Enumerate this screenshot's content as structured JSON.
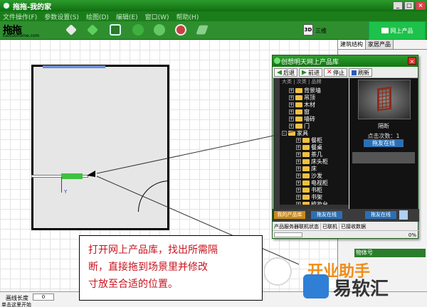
{
  "window": {
    "title": "拖拖-我的家",
    "menu": [
      "文件操作(F)",
      "参数设置(S)",
      "绘图(D)",
      "编辑(E)",
      "窗口(W)",
      "帮助(H)"
    ],
    "min": "_",
    "max": "□",
    "close": "×"
  },
  "logo": {
    "mark": "拖拖",
    "url": "tuotuohome.com"
  },
  "toolbar": {
    "btn_3d": "3D",
    "label_3d": "三维",
    "online_label": "网上产品"
  },
  "right_panel": {
    "tabs": [
      "建筑结构",
      "家居产品"
    ],
    "property_label": "物体号"
  },
  "canvas": {
    "axis_label": "Y"
  },
  "status": {
    "length_label": "画线长度",
    "length_value": "0",
    "hint": "单击这里开始"
  },
  "dialog": {
    "title": "创想明天网上产品库",
    "nav": [
      {
        "label": "后退",
        "icon": "back-arrow-icon",
        "color": "#2a8a2a"
      },
      {
        "label": "前进",
        "icon": "forward-arrow-icon",
        "color": "#2a8a2a"
      },
      {
        "label": "停止",
        "icon": "stop-icon",
        "color": "#cc2222"
      },
      {
        "label": "刷新",
        "icon": "refresh-icon",
        "color": "#2a5ab8"
      }
    ],
    "tree_tabs": "大类 | 次类 | 品牌",
    "tree": [
      {
        "label": "背景墙",
        "level": 1
      },
      {
        "label": "吊顶",
        "level": 1
      },
      {
        "label": "木材",
        "level": 1
      },
      {
        "label": "窗",
        "level": 1
      },
      {
        "label": "墙砖",
        "level": 1
      },
      {
        "label": "门",
        "level": 1
      },
      {
        "label": "家具",
        "level": 0
      },
      {
        "label": "餐柜",
        "level": 2
      },
      {
        "label": "餐桌",
        "level": 2
      },
      {
        "label": "茶几",
        "level": 2
      },
      {
        "label": "床头柜",
        "level": 2
      },
      {
        "label": "床",
        "level": 2
      },
      {
        "label": "沙发",
        "level": 2
      },
      {
        "label": "电视柜",
        "level": 2
      },
      {
        "label": "书柜",
        "level": 2
      },
      {
        "label": "书架",
        "level": 2
      },
      {
        "label": "梳妆台",
        "level": 2
      }
    ],
    "preview_name": "隔断",
    "preview_clicks": "点击次数：1",
    "preview_button": "拖友在线",
    "bottom_buttons": [
      "我的产品库",
      "拖友在线",
      "拖友在线"
    ],
    "status": {
      "server_label": "产品服务器联机状态",
      "server_value": "已联机",
      "received_label": "已接收数据",
      "progress_text": "0%",
      "progress": 0
    }
  },
  "callout": {
    "line1": "打开网上产品库，找出所需隔",
    "line2": "断，直接拖到场景里并修改",
    "line3": "寸放至合适的位置。"
  },
  "watermark": {
    "text": "易软汇",
    "orange": "开业助手"
  }
}
